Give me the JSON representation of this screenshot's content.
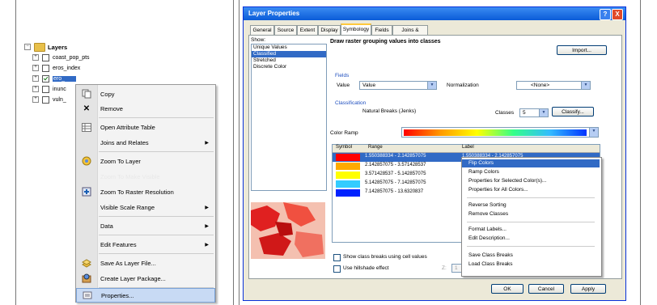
{
  "toc": {
    "root": "Layers",
    "layers": [
      {
        "name": "coast_pop_pts",
        "checked": false
      },
      {
        "name": "eros_index",
        "checked": false
      },
      {
        "name": "ero_",
        "checked": true,
        "selected": true
      },
      {
        "name": "inunc",
        "checked": false
      },
      {
        "name": "vuln_",
        "checked": false
      }
    ]
  },
  "context_menu": {
    "items": [
      {
        "label": "Copy",
        "icon": "copy-icon"
      },
      {
        "label": "Remove",
        "icon": "remove-x-icon"
      },
      {
        "label": "Open Attribute Table",
        "icon": "table-icon",
        "disabled": true
      },
      {
        "label": "Joins and Relates",
        "icon": "",
        "submenu": true
      },
      {
        "label": "Zoom To Layer",
        "icon": "zoom-layer-icon"
      },
      {
        "label": "Zoom To Make Visible",
        "icon": "",
        "disabled": true
      },
      {
        "label": "Zoom To Raster Resolution",
        "icon": "zoom-raster-icon"
      },
      {
        "label": "Visible Scale Range",
        "icon": "",
        "submenu": true
      },
      {
        "label": "Data",
        "icon": "",
        "submenu": true
      },
      {
        "label": "Edit Features",
        "icon": "",
        "submenu": true
      },
      {
        "label": "Save As Layer File...",
        "icon": "layer-file-icon"
      },
      {
        "label": "Create Layer Package...",
        "icon": "layer-package-icon"
      },
      {
        "label": "Properties...",
        "icon": "properties-icon",
        "selected": true
      }
    ]
  },
  "dialog": {
    "title": "Layer Properties",
    "help_btn": "?",
    "close_btn": "X",
    "tabs": [
      "General",
      "Source",
      "Extent",
      "Display",
      "Symbology",
      "Fields",
      "Joins & Relates"
    ],
    "active_tab": "Symbology",
    "show_label": "Show:",
    "show_items": [
      "Unique Values",
      "Classified",
      "Stretched",
      "Discrete Color"
    ],
    "selected_show": "Classified",
    "heading": "Draw raster grouping values into classes",
    "import_btn": "Import...",
    "fields_label": "Fields",
    "value_label": "Value",
    "value": "Value",
    "normalization_label": "Normalization",
    "normalization_value": "<None>",
    "classification_label": "Classification",
    "classification_method": "Natural Breaks (Jenks)",
    "classes_label": "Classes",
    "classes_value": "5",
    "classify_btn": "Classify...",
    "color_ramp_label": "Color Ramp",
    "col_symbol": "Symbol",
    "col_range": "Range",
    "col_label": "Label",
    "rows": [
      {
        "color": "#ff0000",
        "range": "1.550388334 - 2.142857075",
        "label": "1.550388334 - 2.142857075"
      },
      {
        "color": "#ffaa00",
        "range": "2.142857075 - 3.571428537",
        "label": "2.14285"
      },
      {
        "color": "#ffff00",
        "range": "3.571428537 - 5.142857075",
        "label": "3.57142"
      },
      {
        "color": "#33ccff",
        "range": "5.142857075 - 7.142857075",
        "label": "5.14285"
      },
      {
        "color": "#0022ff",
        "range": "7.142857075 - 13.6320837",
        "label": "7.14285"
      }
    ],
    "show_breaks": "Show class breaks using cell values",
    "hillshade": "Use hillshade effect",
    "z_label": "Z:",
    "z_value": "1",
    "ok": "OK",
    "cancel": "Cancel",
    "apply": "Apply"
  },
  "symbol_menu": {
    "items": [
      {
        "label": "Flip Colors",
        "selected": true
      },
      {
        "label": "Ramp Colors"
      },
      {
        "label": "Properties for Selected Color(s)..."
      },
      {
        "label": "Properties for All Colors..."
      },
      {
        "label": "Reverse Sorting",
        "sep_before": true
      },
      {
        "label": "Remove Classes"
      },
      {
        "label": "Format Labels...",
        "sep_before": true
      },
      {
        "label": "Edit Description..."
      },
      {
        "label": "Save Class Breaks",
        "sep_before": true
      },
      {
        "label": "Load Class Breaks"
      }
    ]
  },
  "colors": {
    "accent": "#316ac5",
    "titlebar": "#0a5bd8"
  }
}
